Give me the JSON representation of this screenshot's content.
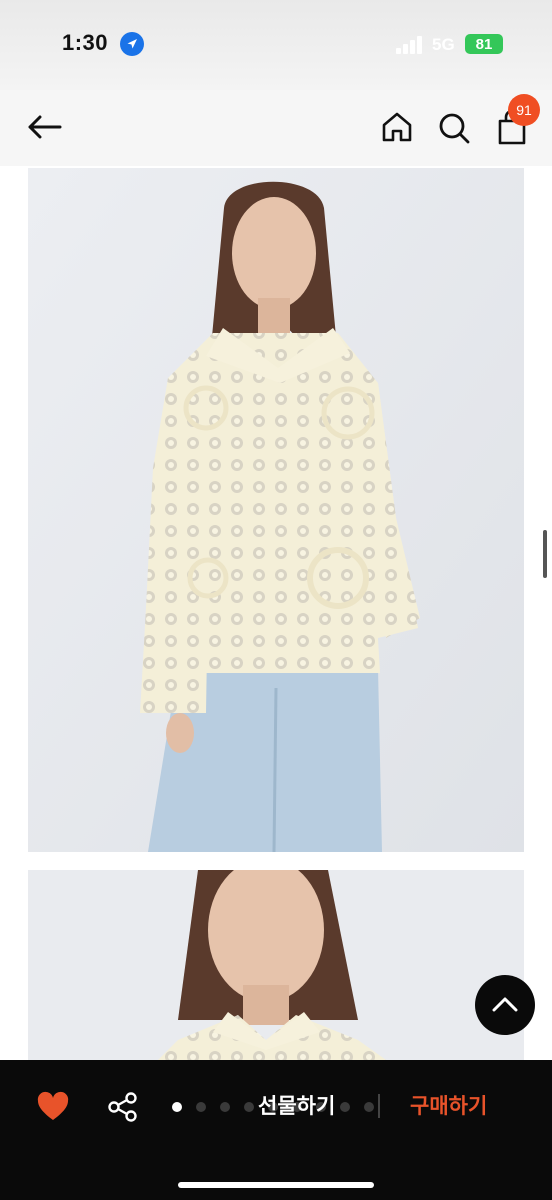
{
  "status_bar": {
    "time": "1:30",
    "network": "5G",
    "battery": "81"
  },
  "header": {
    "cart_count": "91"
  },
  "bottom_bar": {
    "gift_label": "선물하기",
    "buy_label": "구매하기"
  },
  "carousel": {
    "total_pages": 9,
    "current_page": 1
  },
  "colors": {
    "accent": "#e8532a",
    "badge": "#f04e23",
    "bottom_bar_bg": "#0a0a0a"
  },
  "icons": [
    "back-arrow-icon",
    "home-icon",
    "search-icon",
    "shopping-bag-icon",
    "heart-icon",
    "share-icon",
    "chevron-up-icon",
    "location-arrow-icon"
  ]
}
